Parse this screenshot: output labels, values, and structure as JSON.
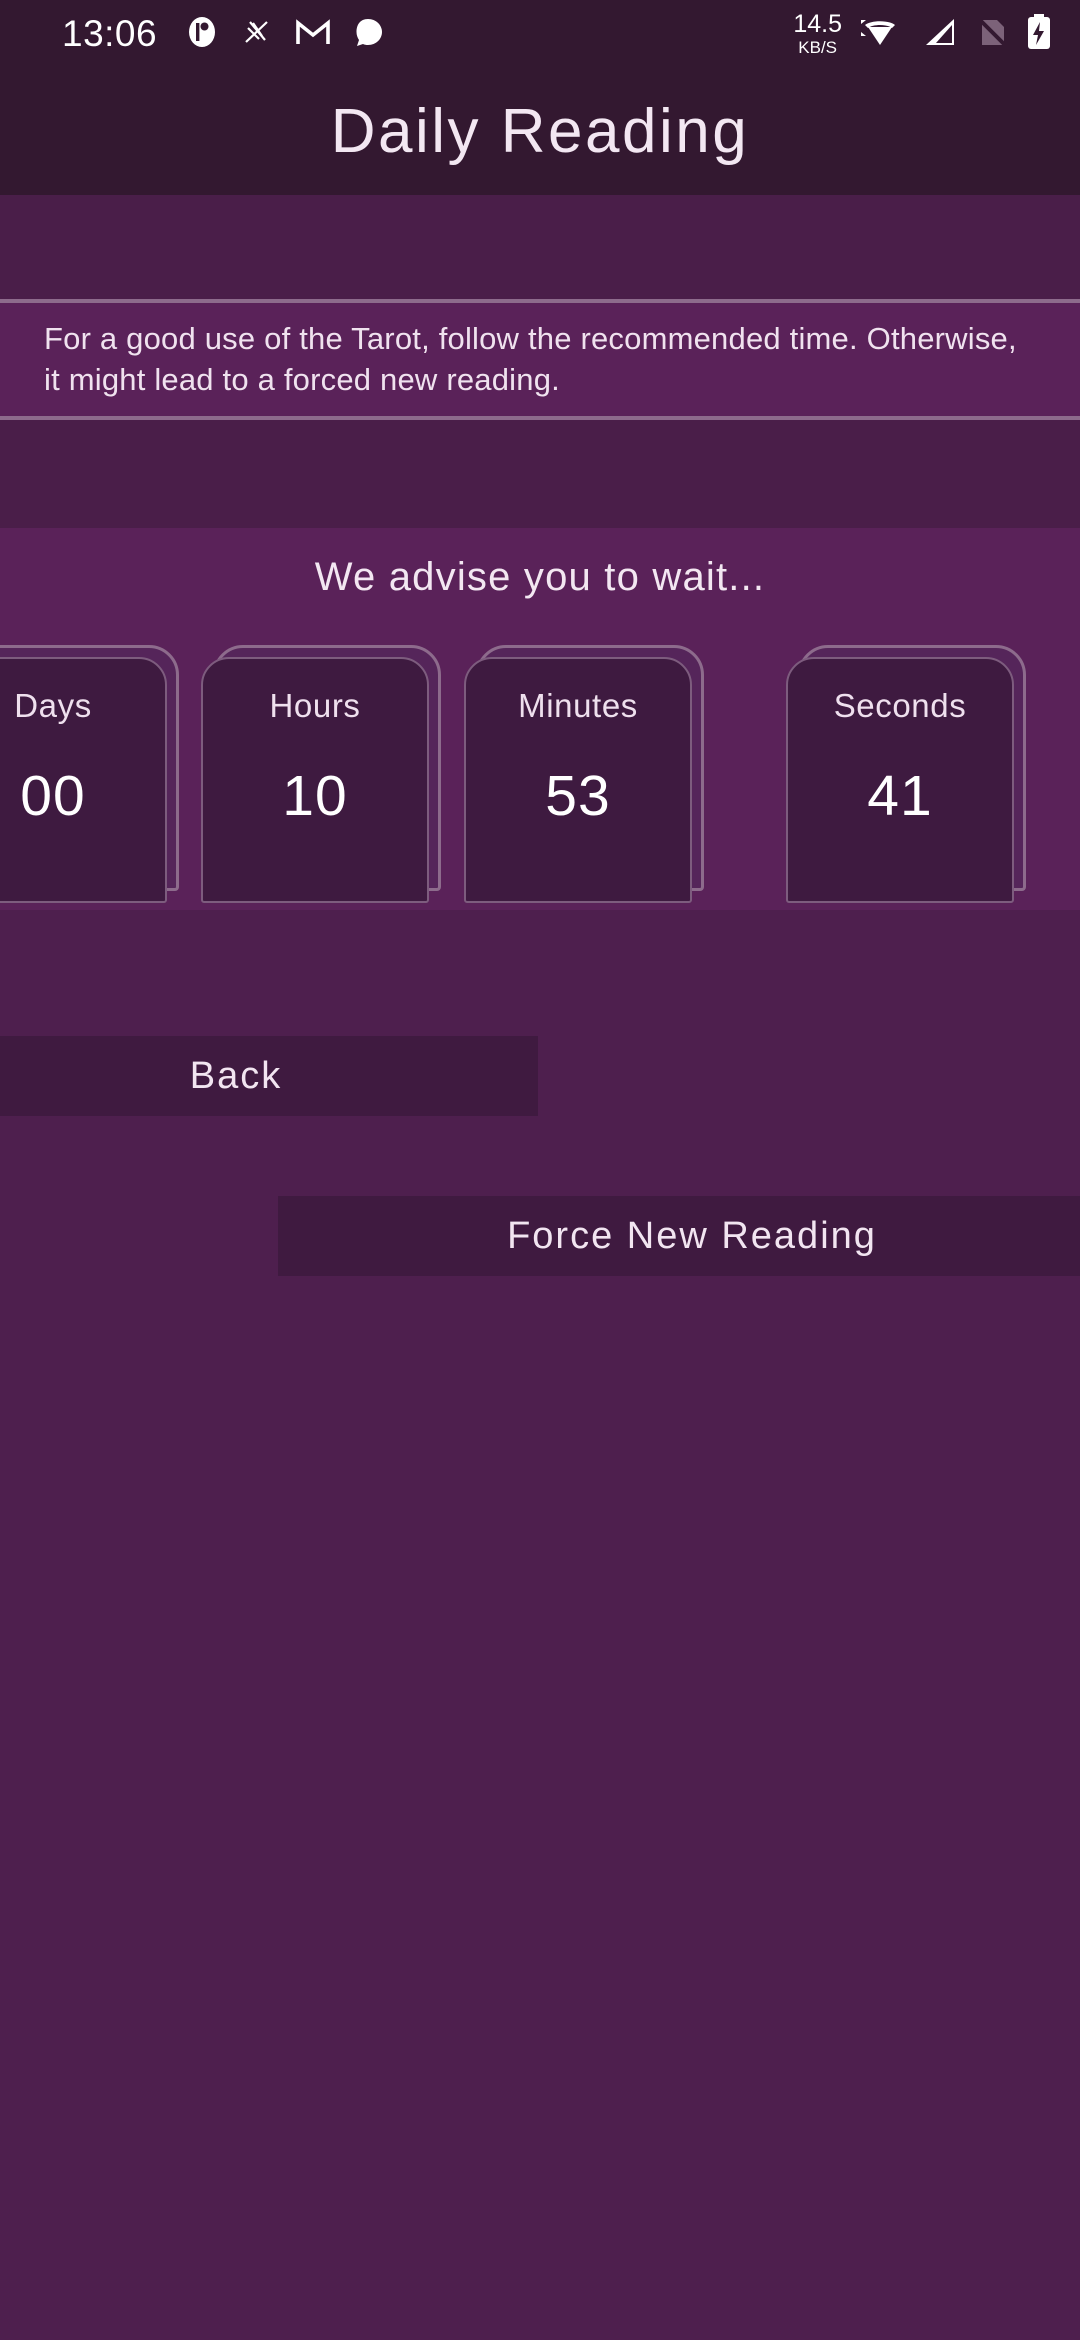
{
  "statusbar": {
    "time": "13:06",
    "icons_left": [
      "pocketcasts-icon",
      "scissors-app-icon",
      "gmail-icon",
      "messenger-icon"
    ],
    "network_speed_value": "14.5",
    "network_speed_unit": "KB/S",
    "icons_right": [
      "wifi-icon",
      "cellular-signal-icon",
      "sim-off-icon",
      "battery-charging-icon"
    ]
  },
  "header": {
    "title": "Daily Reading"
  },
  "description": {
    "text": "For a good use of the Tarot, follow the recommended time. Otherwise, it might lead to a forced new reading."
  },
  "countdown": {
    "heading": "We advise you to wait...",
    "units": [
      {
        "label": "Days",
        "value": "00"
      },
      {
        "label": "Hours",
        "value": "10"
      },
      {
        "label": "Minutes",
        "value": "53"
      },
      {
        "label": "Seconds",
        "value": "41"
      }
    ]
  },
  "actions": {
    "back_label": "Back",
    "force_label": "Force New Reading"
  },
  "colors": {
    "header_bg": "#331830",
    "page_bg": "#5a2259",
    "band_dark": "#4a1e49",
    "card_bg": "#3e1a40",
    "divider": "#8d6b8c",
    "text": "#f3e7f2"
  }
}
